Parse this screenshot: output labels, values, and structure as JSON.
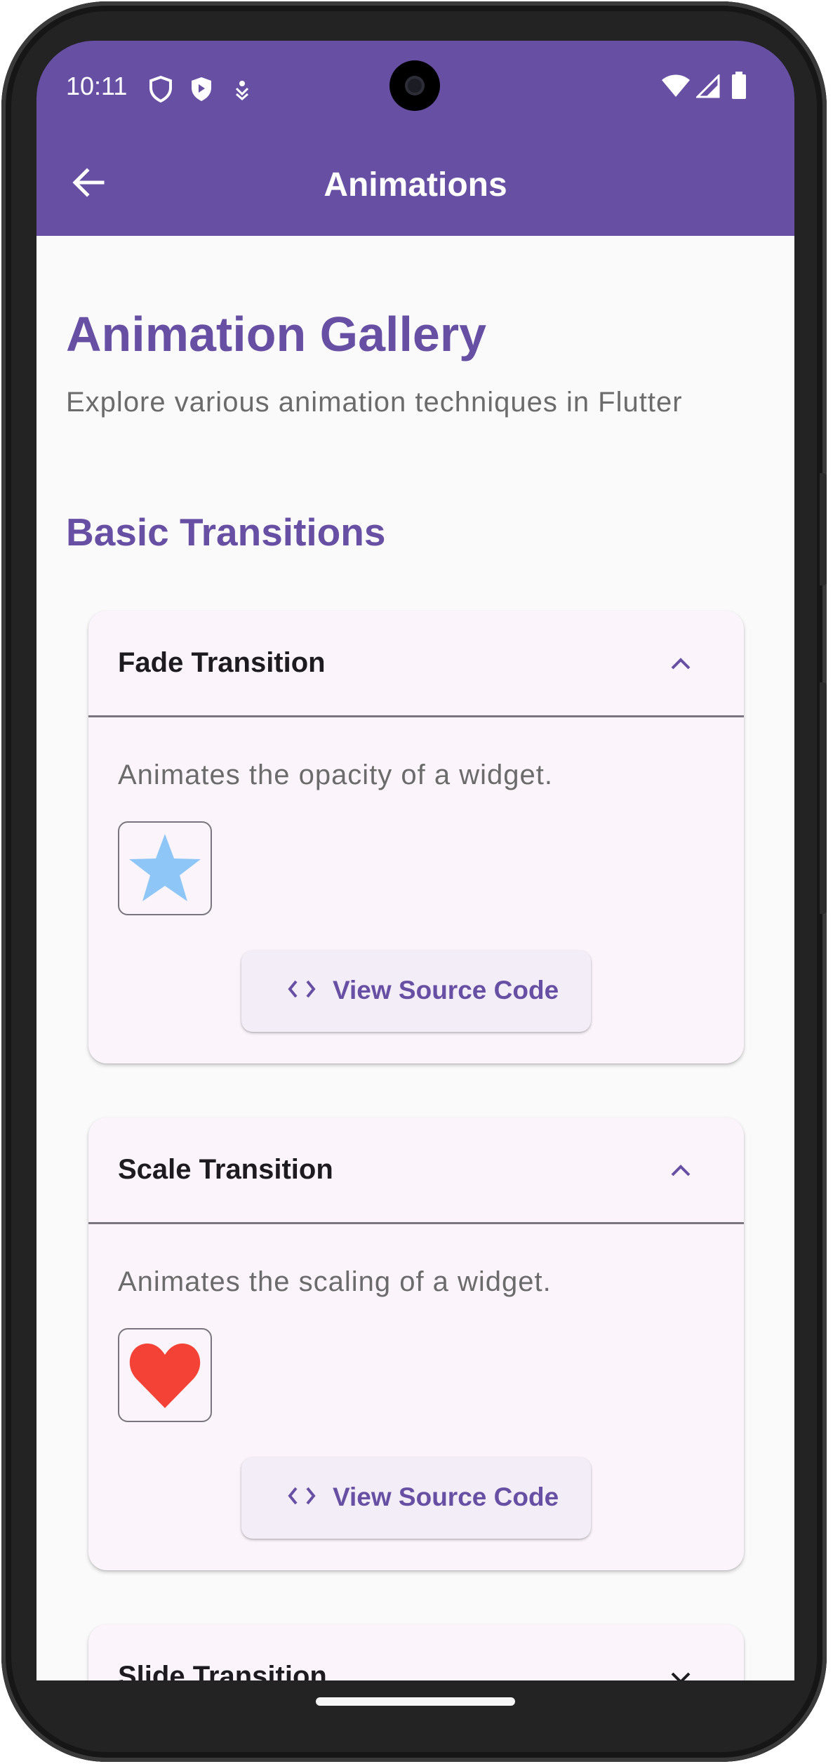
{
  "status_bar": {
    "time": "10:11"
  },
  "app_bar": {
    "title": "Animations",
    "back_icon": "arrow-back-icon"
  },
  "page": {
    "title": "Animation Gallery",
    "subtitle": "Explore various animation techniques in Flutter"
  },
  "section": {
    "title": "Basic Transitions"
  },
  "cards": [
    {
      "title": "Fade Transition",
      "expanded": true,
      "description": "Animates the opacity of a widget.",
      "demo_icon": "star-icon",
      "demo_color": "#8ec7f7",
      "button_label": "View Source Code"
    },
    {
      "title": "Scale Transition",
      "expanded": true,
      "description": "Animates the scaling of a widget.",
      "demo_icon": "heart-icon",
      "demo_color": "#f44336",
      "button_label": "View Source Code"
    },
    {
      "title": "Slide Transition",
      "expanded": false
    }
  ],
  "colors": {
    "primary": "#6750a4",
    "card_bg": "#fbf5fb",
    "button_bg": "#f3edf7"
  }
}
